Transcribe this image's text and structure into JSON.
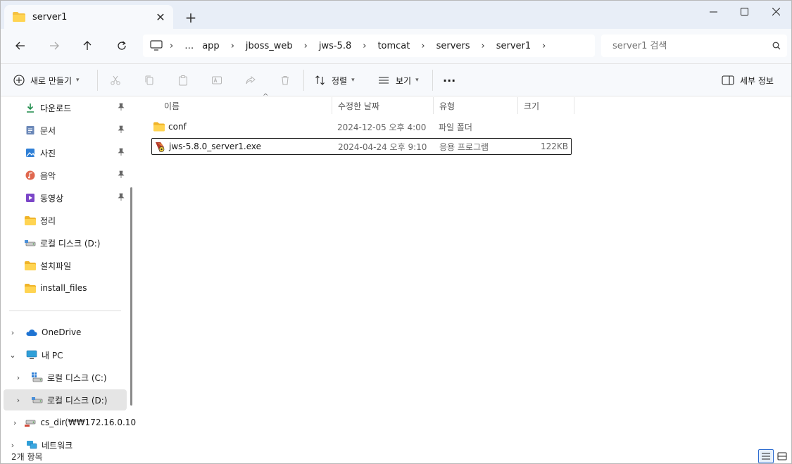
{
  "window": {
    "tab_title": "server1",
    "new_tab": "+",
    "controls": {
      "minimize": "minimize",
      "maximize": "maximize",
      "close": "close"
    }
  },
  "nav": {
    "breadcrumb": [
      "…",
      "app",
      "jboss_web",
      "jws-5.8",
      "tomcat",
      "servers",
      "server1"
    ],
    "search_placeholder": "server1 검색"
  },
  "toolbar": {
    "new_label": "새로 만들기",
    "sort_label": "정렬",
    "view_label": "보기",
    "more_label": "···",
    "details_label": "세부 정보"
  },
  "sidebar": {
    "quick_access": [
      {
        "label": "다운로드",
        "icon": "download-icon",
        "pinned": true
      },
      {
        "label": "문서",
        "icon": "document-icon",
        "pinned": true
      },
      {
        "label": "사진",
        "icon": "pictures-icon",
        "pinned": true
      },
      {
        "label": "음악",
        "icon": "music-icon",
        "pinned": true
      },
      {
        "label": "동영상",
        "icon": "video-icon",
        "pinned": true
      },
      {
        "label": "정리",
        "icon": "folder-icon",
        "pinned": false
      },
      {
        "label": "로컬 디스크 (D:)",
        "icon": "drive-icon",
        "pinned": false
      },
      {
        "label": "설치파일",
        "icon": "folder-icon",
        "pinned": false
      },
      {
        "label": "install_files",
        "icon": "folder-icon",
        "pinned": false
      }
    ],
    "tree": [
      {
        "label": "OneDrive",
        "icon": "cloud-icon",
        "expander": ">"
      },
      {
        "label": "내 PC",
        "icon": "pc-icon",
        "expander": "v"
      },
      {
        "label": "로컬 디스크 (C:)",
        "icon": "windows-drive-icon",
        "expander": ">"
      },
      {
        "label": "로컬 디스크 (D:)",
        "icon": "drive-icon",
        "expander": ">"
      },
      {
        "label": "cs_dir(₩₩172.16.0.10",
        "icon": "network-drive-icon",
        "expander": ">"
      },
      {
        "label": "네트워크",
        "icon": "network-icon",
        "expander": ">"
      }
    ]
  },
  "columns": {
    "name": "이름",
    "date": "수정한 날짜",
    "type": "유형",
    "size": "크기"
  },
  "files": [
    {
      "name": "conf",
      "date": "2024-12-05 오후 4:00",
      "type": "파일 폴더",
      "size": "",
      "icon": "folder-icon"
    },
    {
      "name": "jws-5.8.0_server1.exe",
      "date": "2024-04-24 오후 9:10",
      "type": "응용 프로그램",
      "size": "122KB",
      "icon": "exe-icon"
    }
  ],
  "status": {
    "item_count": "2개 항목"
  },
  "colors": {
    "accent": "#2a6ad0",
    "folder": "#f5c242",
    "titlebar": "#e8eef7"
  }
}
